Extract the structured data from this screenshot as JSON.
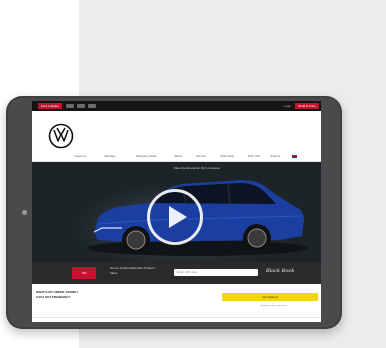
{
  "topbar": {
    "left_tab": "Find a Dealer",
    "right_text": "Login",
    "cta": "Build & Price"
  },
  "nav": {
    "items": [
      "Inventory",
      "Vehicles",
      "Shopping Tools",
      "Offers",
      "Service",
      "Ownership",
      "Why VW",
      "Owners"
    ]
  },
  "hero": {
    "caption": "Meet the all-electric ID.4 crossover"
  },
  "offer": {
    "badge": "VW",
    "line1": "Get an Instant Estimated Trade-in",
    "line2": "Value",
    "line3": "",
    "placeholder": "Enter ZIP code",
    "signature": "Black Book"
  },
  "bottom": {
    "question1": "WHAT'S MY CREDIT SCORE?",
    "question2": "CAN I GET FINANCING?",
    "yellow_button": "Get Started",
    "fine_print": "No impact to your credit score"
  },
  "colors": {
    "brand_red": "#c8102e",
    "accent_yellow": "#f3d21b",
    "vw_blue": "#001e50"
  }
}
